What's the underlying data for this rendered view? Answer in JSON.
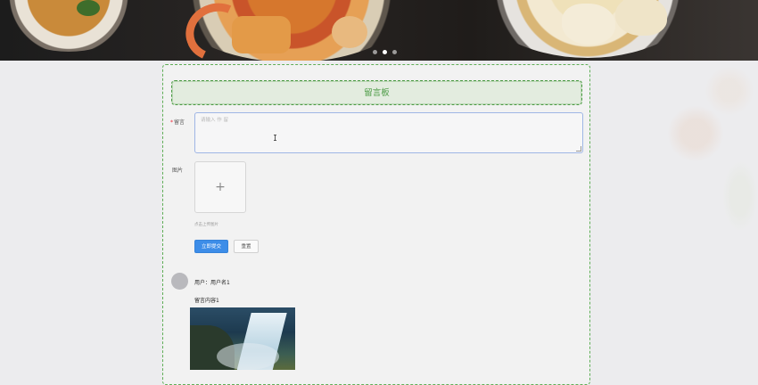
{
  "board": {
    "title": "留言板",
    "message_label_required": "*",
    "message_label": "留言",
    "message_placeholder": "请输入 作 留",
    "image_label": "图片",
    "upload_plus": "+",
    "upload_tip": "点击上传图片",
    "submit_label": "立即提交",
    "reset_label": "重置"
  },
  "comment": {
    "user_text": "用户：用户名1",
    "content_text": "留言内容1"
  },
  "colors": {
    "accent_green": "#4c9b45",
    "primary_blue": "#3d8de8"
  }
}
